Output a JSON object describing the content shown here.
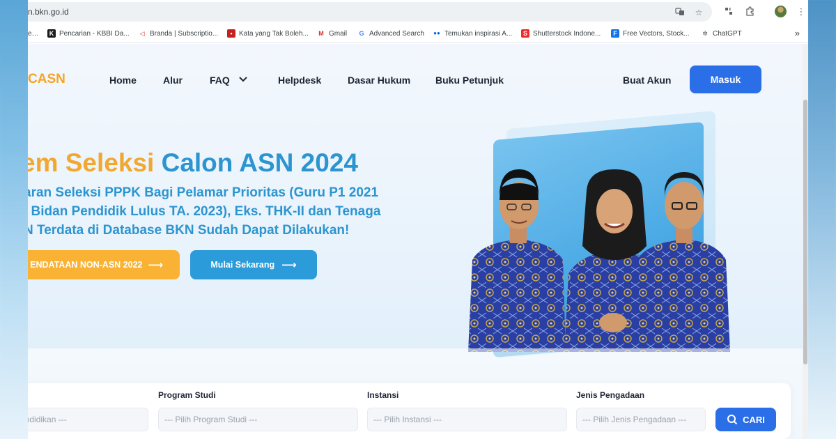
{
  "browser": {
    "url": "n.bkn.go.id",
    "bookmarks": [
      {
        "label": "e…",
        "icon": "bookmark-icon"
      },
      {
        "label": "Pencarian - KBBI Da...",
        "icon": "kbbi-icon"
      },
      {
        "label": "Branda | Subscriptio...",
        "icon": "branda-icon"
      },
      {
        "label": "Kata yang Tak Boleh...",
        "icon": "kata-icon"
      },
      {
        "label": "Gmail",
        "icon": "gmail-icon"
      },
      {
        "label": "Advanced Search",
        "icon": "google-icon"
      },
      {
        "label": "Temukan inspirasi A...",
        "icon": "flickr-icon"
      },
      {
        "label": "Shutterstock Indone...",
        "icon": "shutterstock-icon"
      },
      {
        "label": "Free Vectors, Stock...",
        "icon": "freepik-icon"
      },
      {
        "label": "ChatGPT",
        "icon": "chatgpt-icon"
      }
    ],
    "more": "»"
  },
  "site": {
    "logo_text": "CASN",
    "nav": [
      "Home",
      "Alur",
      "FAQ",
      "Helpdesk",
      "Dasar Hukum",
      "Buku Petunjuk"
    ],
    "signup_label": "Buat Akun",
    "login_label": "Masuk"
  },
  "hero": {
    "title_part1": "em Seleksi",
    "title_part2": " Calon ASN 2024",
    "subtitle_lines": [
      "aran Seleksi PPPK Bagi Pelamar Prioritas (Guru P1 2021",
      "/ Bidan Pendidik Lulus TA. 2023), Eks. THK-II dan Tenaga",
      "N Terdata di Database BKN Sudah Dapat Dilakukan!"
    ],
    "btn_pendataan": "ENDATAAN NON-ASN 2022",
    "btn_mulai": "Mulai Sekarang",
    "arrow": "⟶"
  },
  "search": {
    "fields": [
      {
        "label": "",
        "placeholder": "endidikan ---"
      },
      {
        "label": "Program Studi",
        "placeholder": "--- Pilih Program Studi ---"
      },
      {
        "label": "Instansi",
        "placeholder": "--- Pilih Instansi ---"
      },
      {
        "label": "Jenis Pengadaan",
        "placeholder": "--- Pilih Jenis Pengadaan ---"
      }
    ],
    "button": "CARI"
  },
  "colors": {
    "primary_blue": "#2b6fe8",
    "hero_blue": "#2c95d0",
    "accent_orange": "#f0a830"
  }
}
